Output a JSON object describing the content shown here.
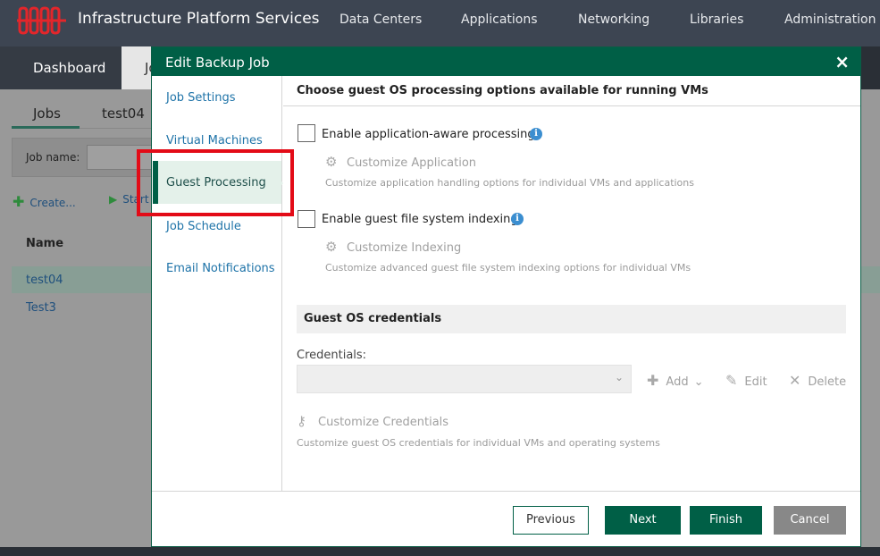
{
  "header": {
    "brand": "Infrastructure Platform Services",
    "nav": [
      "Data Centers",
      "Applications",
      "Networking",
      "Libraries",
      "Administration"
    ]
  },
  "background": {
    "dashboard_tab": "Dashboard",
    "partial_tab": "Jo",
    "sub_tabs": [
      "Jobs",
      "test04"
    ],
    "filter_label": "Job name:",
    "create_label": "Create...",
    "start_label": "Start",
    "column_name": "Name",
    "rows": [
      "test04",
      "Test3"
    ]
  },
  "dialog": {
    "title": "Edit Backup Job",
    "close": "×",
    "sidebar": {
      "items": [
        "Job Settings",
        "Virtual Machines",
        "Guest Processing",
        "Job Schedule",
        "Email Notifications"
      ],
      "active": "Guest Processing"
    },
    "content_heading": "Choose guest OS processing options available for running VMs",
    "app_aware": {
      "label": "Enable application-aware processing",
      "customize": "Customize Application",
      "description": "Customize application handling options for individual VMs and applications"
    },
    "indexing": {
      "label": "Enable guest file system indexing",
      "customize": "Customize Indexing",
      "description": "Customize advanced guest file system indexing options for individual VMs"
    },
    "credentials_section": "Guest OS credentials",
    "credentials_label": "Credentials:",
    "tools": {
      "add": "Add",
      "edit": "Edit",
      "delete": "Delete"
    },
    "customize_credentials": "Customize Credentials",
    "credentials_description": "Customize guest OS credentials for individual VMs and operating systems",
    "buttons": {
      "previous": "Previous",
      "next": "Next",
      "finish": "Finish",
      "cancel": "Cancel"
    }
  },
  "colors": {
    "accent": "#005f46",
    "header": "#3d4552",
    "highlight": "#e30b17",
    "link": "#1e73a8"
  }
}
